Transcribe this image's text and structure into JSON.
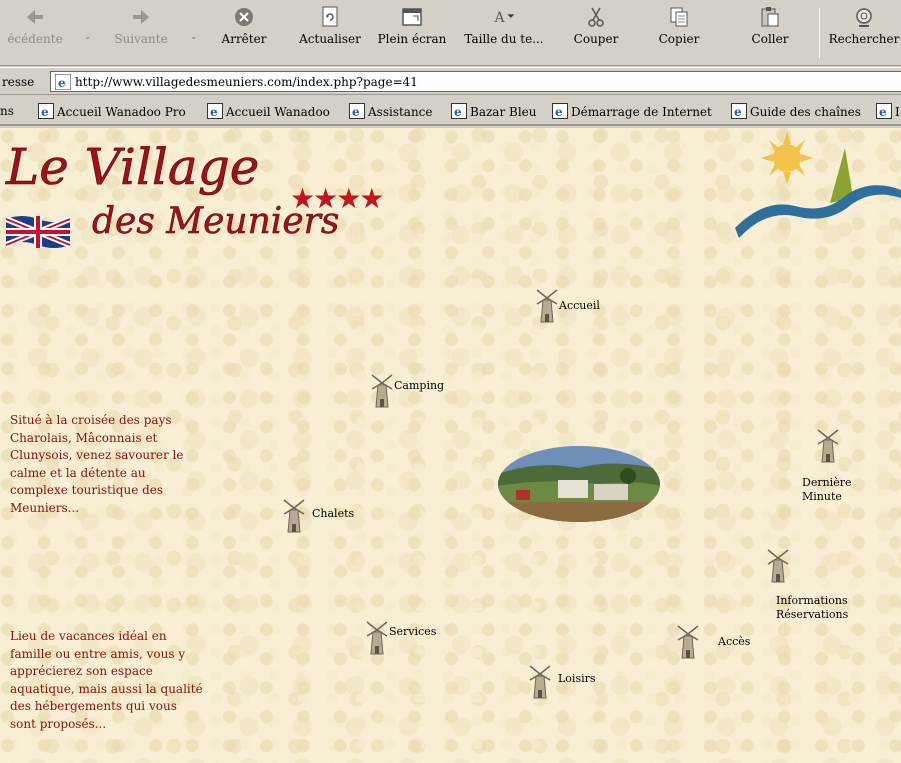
{
  "toolbar": {
    "buttons": [
      {
        "label": "écédente",
        "icon": "back-arrow-icon"
      },
      {
        "label": "Suivante",
        "icon": "forward-arrow-icon"
      },
      {
        "label": "Arrêter",
        "icon": "stop-icon"
      },
      {
        "label": "Actualiser",
        "icon": "refresh-icon"
      },
      {
        "label": "Plein écran",
        "icon": "fullscreen-icon"
      },
      {
        "label": "Taille du te...",
        "icon": "text-size-icon"
      },
      {
        "label": "Couper",
        "icon": "scissors-icon"
      },
      {
        "label": "Copier",
        "icon": "copy-icon"
      },
      {
        "label": "Coller",
        "icon": "paste-icon"
      },
      {
        "label": "Rechercher",
        "icon": "search-icon"
      }
    ]
  },
  "address": {
    "label": "resse",
    "url": "http://www.villagedesmeuniers.com/index.php?page=41"
  },
  "links": {
    "label": "ns",
    "items": [
      "Accueil Wanadoo Pro",
      "Accueil Wanadoo",
      "Assistance",
      "Bazar Bleu",
      "Démarrage de Internet",
      "Guide des chaînes",
      "I"
    ]
  },
  "page": {
    "logo": {
      "line1": "Le Village",
      "line2": "des Meuniers",
      "stars": "★★★★"
    },
    "nav": {
      "accueil": "Accueil",
      "camping": "Camping",
      "chalets": "Chalets",
      "derniere_1": "Dernière",
      "derniere_2": "Minute",
      "infos_1": "Informations",
      "infos_2": "Réservations",
      "services": "Services",
      "acces": "Accès",
      "loisirs": "Loisirs"
    },
    "intro_1": [
      "Situé à la croisée des pays",
      "Charolais, Mâconnais et",
      "Clunysois, venez savourer le",
      "calme et la détente au",
      "complexe touristique des",
      "Meuniers..."
    ],
    "intro_2": [
      "Lieu de vacances idéal en",
      "famille ou entre amis, vous y",
      "apprécierez son espace",
      "aquatique, mais aussi la qualité",
      "des hébergements qui vous",
      "sont proposés..."
    ]
  },
  "colors": {
    "page_bg": "#f7eed4",
    "intro_text": "#8a1010",
    "logo_red": "#a0101a",
    "star_red": "#c0141e"
  }
}
